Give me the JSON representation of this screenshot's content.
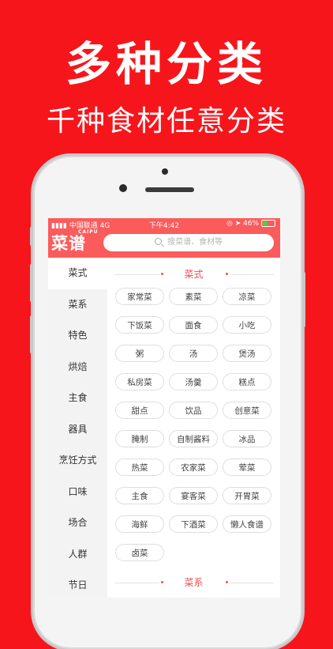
{
  "promo": {
    "headline": "多种分类",
    "subline": "千种食材任意分类"
  },
  "status_bar": {
    "carrier": "中国联通",
    "network": "4G",
    "time": "下午4:42",
    "battery": "46%"
  },
  "app": {
    "logo_text": "菜谱",
    "logo_sup": "CAIPU",
    "search_placeholder": "搜菜谱、食材等"
  },
  "sidebar": {
    "items": [
      {
        "label": "菜式",
        "active": true
      },
      {
        "label": "菜系"
      },
      {
        "label": "特色"
      },
      {
        "label": "烘焙"
      },
      {
        "label": "主食"
      },
      {
        "label": "器具"
      },
      {
        "label": "烹饪方式"
      },
      {
        "label": "口味"
      },
      {
        "label": "场合"
      },
      {
        "label": "人群"
      },
      {
        "label": "节日"
      }
    ]
  },
  "content": {
    "section1_title": "菜式",
    "section2_title": "菜系",
    "tags": [
      "家常菜",
      "素菜",
      "凉菜",
      "下饭菜",
      "面食",
      "小吃",
      "粥",
      "汤",
      "煲汤",
      "私房菜",
      "汤羹",
      "糕点",
      "甜点",
      "饮品",
      "创意菜",
      "腌制",
      "自制酱料",
      "冰品",
      "热菜",
      "农家菜",
      "荤菜",
      "主食",
      "宴客菜",
      "开胃菜",
      "海鲜",
      "下酒菜",
      "懒人食谱",
      "卤菜"
    ]
  },
  "colors": {
    "background": "#f7151c",
    "header": "#fb5b5b",
    "accent": "#f05050"
  }
}
